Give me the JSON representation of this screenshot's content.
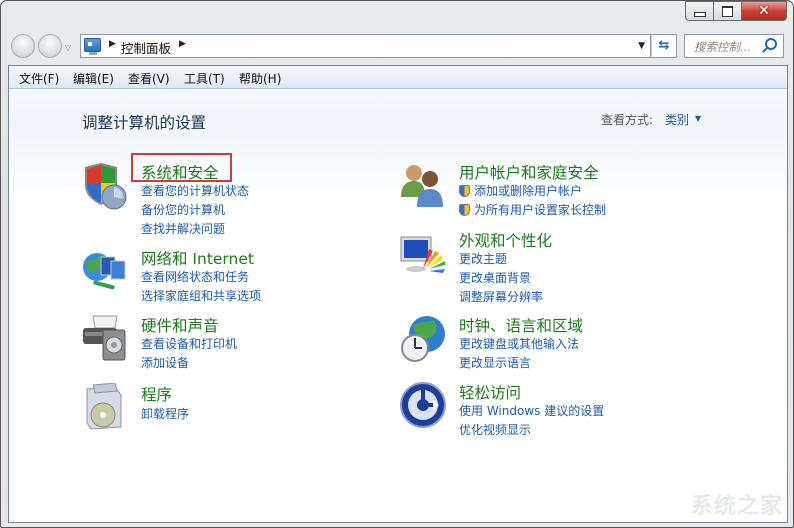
{
  "window": {
    "controls": {
      "minimize": "minimize",
      "maximize": "maximize",
      "close": "✕"
    }
  },
  "nav": {
    "breadcrumb": [
      "控制面板"
    ],
    "search_placeholder": "搜索控制..."
  },
  "menubar": {
    "items": [
      "文件(F)",
      "编辑(E)",
      "查看(V)",
      "工具(T)",
      "帮助(H)"
    ]
  },
  "main": {
    "title": "调整计算机的设置",
    "view_by_label": "查看方式:",
    "view_by_value": "类别",
    "categories": [
      {
        "title": "系统和安全",
        "icon": "shield-icon",
        "links": [
          "查看您的计算机状态",
          "备份您的计算机",
          "查找并解决问题"
        ],
        "highlighted": true
      },
      {
        "title": "网络和 Internet",
        "icon": "network-icon",
        "links": [
          "查看网络状态和任务",
          "选择家庭组和共享选项"
        ]
      },
      {
        "title": "硬件和声音",
        "icon": "printer-icon",
        "links": [
          "查看设备和打印机",
          "添加设备"
        ]
      },
      {
        "title": "程序",
        "icon": "programs-icon",
        "links": [
          "卸载程序"
        ]
      },
      {
        "title": "用户帐户和家庭安全",
        "icon": "users-icon",
        "links": [
          "添加或删除用户帐户",
          "为所有用户设置家长控制"
        ],
        "shield_links": true
      },
      {
        "title": "外观和个性化",
        "icon": "appearance-icon",
        "links": [
          "更改主题",
          "更改桌面背景",
          "调整屏幕分辨率"
        ]
      },
      {
        "title": "时钟、语言和区域",
        "icon": "clock-globe-icon",
        "links": [
          "更改键盘或其他输入法",
          "更改显示语言"
        ]
      },
      {
        "title": "轻松访问",
        "icon": "ease-of-access-icon",
        "links": [
          "使用 Windows 建议的设置",
          "优化视频显示"
        ]
      }
    ]
  },
  "watermark": "系统之家"
}
